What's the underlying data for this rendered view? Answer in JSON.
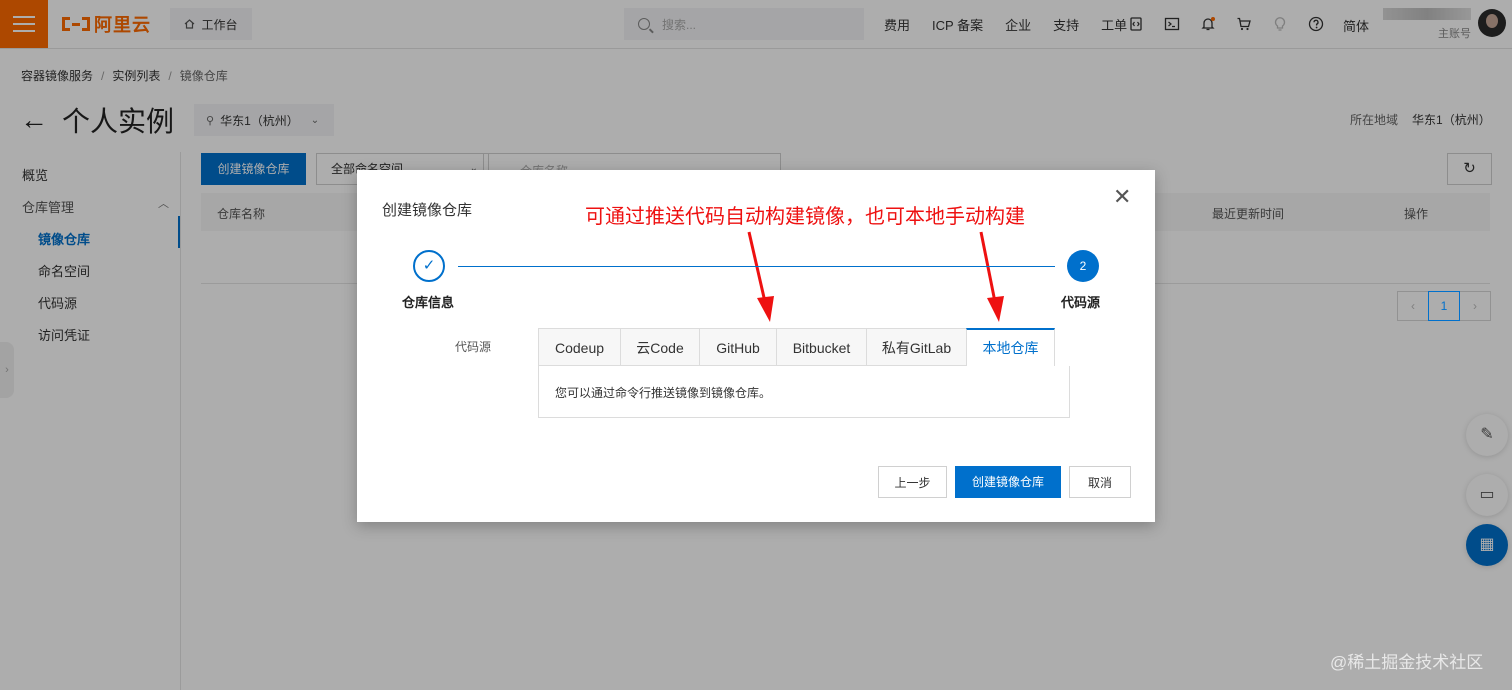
{
  "topbar": {
    "logo_text": "阿里云",
    "workbench": "工作台",
    "search_placeholder": "搜索...",
    "links": [
      "费用",
      "ICP 备案",
      "企业",
      "支持",
      "工单"
    ],
    "language": "简体",
    "account_label": "主账号"
  },
  "breadcrumb": {
    "items": [
      "容器镜像服务",
      "实例列表",
      "镜像仓库"
    ]
  },
  "page": {
    "title": "个人实例",
    "region": "华东1（杭州）",
    "region_right_label": "所在地域",
    "region_right_value": "华东1（杭州）"
  },
  "sidebar": {
    "items": [
      {
        "label": "概览"
      },
      {
        "label": "仓库管理"
      },
      {
        "label": "镜像仓库"
      },
      {
        "label": "命名空间"
      },
      {
        "label": "代码源"
      },
      {
        "label": "访问凭证"
      }
    ]
  },
  "toolbar": {
    "create_label": "创建镜像仓库",
    "namespace_select": "全部命名空间",
    "search_placeholder": "仓库名称"
  },
  "table": {
    "columns": [
      "仓库名称",
      "最近更新时间",
      "操作"
    ]
  },
  "pager": {
    "current": "1"
  },
  "modal": {
    "title": "创建镜像仓库",
    "annotation": "可通过推送代码自动构建镜像，也可本地手动构建",
    "step1_label": "仓库信息",
    "step2_number": "2",
    "step2_label": "代码源",
    "source_label": "代码源",
    "tabs": [
      "Codeup",
      "云Code",
      "GitHub",
      "Bitbucket",
      "私有GitLab",
      "本地仓库"
    ],
    "active_tab": "本地仓库",
    "panel_text": "您可以通过命令行推送镜像到镜像仓库。",
    "buttons": {
      "prev": "上一步",
      "create": "创建镜像仓库",
      "cancel": "取消"
    }
  },
  "watermark": "@稀土掘金技术社区",
  "colors": {
    "brand_orange": "#ff6a00",
    "primary_blue": "#0070cc",
    "annotation_red": "#ee1111"
  }
}
